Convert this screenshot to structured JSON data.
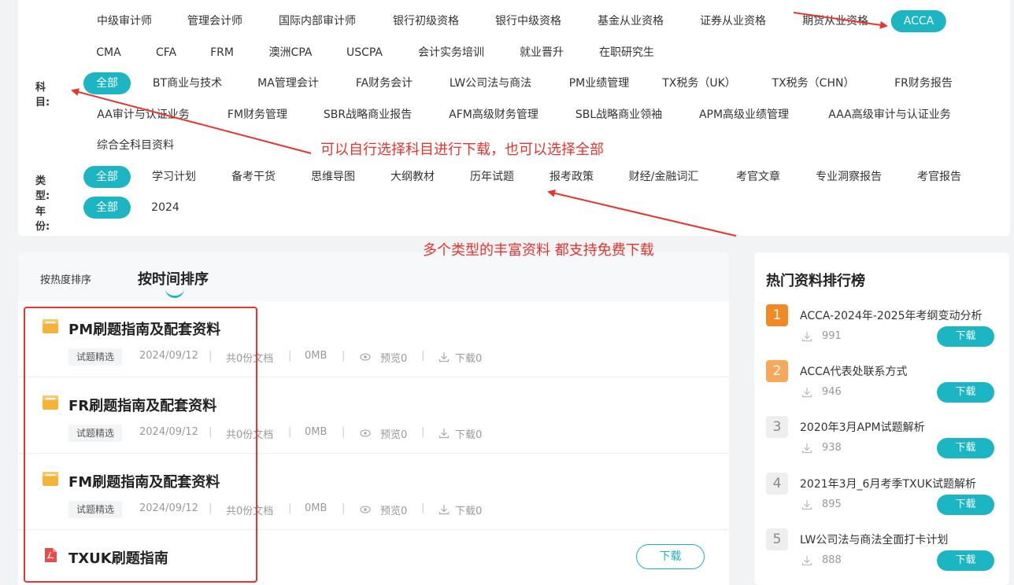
{
  "filters": {
    "exam_row1": [
      "中级审计师",
      "管理会计师",
      "国际内部审计师",
      "银行初级资格",
      "银行中级资格",
      "基金从业资格",
      "证券从业资格",
      "期货从业资格",
      "ACCA"
    ],
    "exam_row2": [
      "CMA",
      "CFA",
      "FRM",
      "澳洲CPA",
      "USCPA",
      "会计实务培训",
      "就业晋升",
      "在职研究生"
    ],
    "subject_label": "科目:",
    "subject_row1": [
      "全部",
      "BT商业与技术",
      "MA管理会计",
      "FA财务会计",
      "LW公司法与商法",
      "PM业绩管理",
      "TX税务（UK）",
      "TX税务（CHN）",
      "FR财务报告"
    ],
    "subject_row2": [
      "AA审计与认证业务",
      "FM财务管理",
      "SBR战略商业报告",
      "AFM高级财务管理",
      "SBL战略商业领袖",
      "APM高级业绩管理",
      "AAA高级审计与认证业务"
    ],
    "subject_row3": [
      "综合全科目资料"
    ],
    "type_label": "类型:",
    "type_row": [
      "全部",
      "学习计划",
      "备考干货",
      "思维导图",
      "大纲教材",
      "历年试题",
      "报考政策",
      "财经/金融词汇",
      "考官文章",
      "专业洞察报告",
      "考官报告"
    ],
    "year_label": "年份:",
    "year_row": [
      "全部",
      "2024"
    ]
  },
  "annotations": {
    "subject_note": "可以自行选择科目进行下载，也可以选择全部",
    "type_note": "多个类型的丰富资料  都支持免费下载"
  },
  "sort": {
    "hot": "按热度排序",
    "time": "按时间排序"
  },
  "items": [
    {
      "title": "PM刷题指南及配套资料",
      "tag": "试题精选",
      "date": "2024/09/12",
      "docs": "共0份文档",
      "size": "0MB",
      "preview": "预览0",
      "downloads": "下载0",
      "icon": "folder-icon"
    },
    {
      "title": "FR刷题指南及配套资料",
      "tag": "试题精选",
      "date": "2024/09/12",
      "docs": "共0份文档",
      "size": "0MB",
      "preview": "预览0",
      "downloads": "下载0",
      "icon": "folder-icon"
    },
    {
      "title": "FM刷题指南及配套资料",
      "tag": "试题精选",
      "date": "2024/09/12",
      "docs": "共0份文档",
      "size": "0MB",
      "preview": "预览0",
      "downloads": "下载0",
      "icon": "folder-icon"
    },
    {
      "title": "TXUK刷题指南",
      "button": "下载",
      "icon": "pdf-icon"
    }
  ],
  "hot": {
    "title": "热门资料排行榜",
    "button_label": "下载",
    "items": [
      {
        "rank": "1",
        "name": "ACCA-2024年-2025年考纲变动分析",
        "count": "991",
        "color": "#f08a24"
      },
      {
        "rank": "2",
        "name": "ACCA代表处联系方式",
        "count": "946",
        "color": "#f7a85a"
      },
      {
        "rank": "3",
        "name": "2020年3月APM试题解析",
        "count": "938",
        "color": "#eeeeee"
      },
      {
        "rank": "4",
        "name": "2021年3月_6月考季TXUK试题解析",
        "count": "895",
        "color": "#eeeeee"
      },
      {
        "rank": "5",
        "name": "LW公司法与商法全面打卡计划",
        "count": "888",
        "color": "#eeeeee"
      }
    ]
  },
  "colors": {
    "accent": "#1cb5c4",
    "annotation": "#e8342e"
  }
}
